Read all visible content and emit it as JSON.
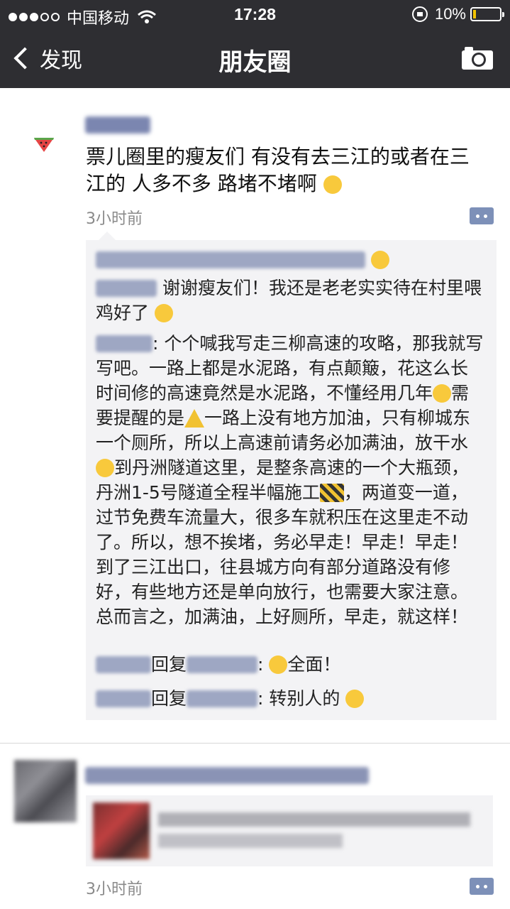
{
  "status_bar": {
    "carrier": "中国移动",
    "time": "17:28",
    "battery": "10%",
    "battery_level": 0.1
  },
  "nav": {
    "back_label": "发现",
    "title": "朋友圈"
  },
  "post1": {
    "avatar_icon": "watermelon-icon",
    "text": "票儿圈里的瘦友们 有没有去三江的或者在三江的 人多不多 路堵不堵啊",
    "time": "3小时前",
    "comments": {
      "c2_text": "谢谢瘦友们！我还是老老实实待在村里喂鸡好了",
      "c3_text_a": ": 个个喊我写走三柳高速的攻略，那我就写写吧。一路上都是水泥路，有点颠簸，花这么长时间修的高速竟然是水泥路，不懂经用几年",
      "c3_text_b": "需要提醒的是",
      "c3_text_c": "一路上没有地方加油，只有柳城东一个厕所，所以上高速前请务必加满油，放干水",
      "c3_text_d": "到丹洲隧道这里，是整条高速的一个大瓶颈，丹洲1-5号隧道全程半幅施工",
      "c3_text_e": "，两道变一道，过节免费车流量大，很多车就积压在这里走不动了。所以，想不挨堵，务必早走！早走！早走！到了三江出口，往县城方向有部分道路没有修好，有些地方还是单向放行，也需要大家注意。总而言之，加满油，上好厕所，早走，就这样！",
      "c4_reply": "回复",
      "c4_text": ":",
      "c4_text2": "全面！",
      "c5_reply": "回复",
      "c5_text": ": 转别人的"
    }
  },
  "post2": {
    "time": "3小时前"
  },
  "colors": {
    "bar_bg": "#2e2e32",
    "link_blue": "#576b95",
    "comment_bg": "#f3f3f5"
  }
}
